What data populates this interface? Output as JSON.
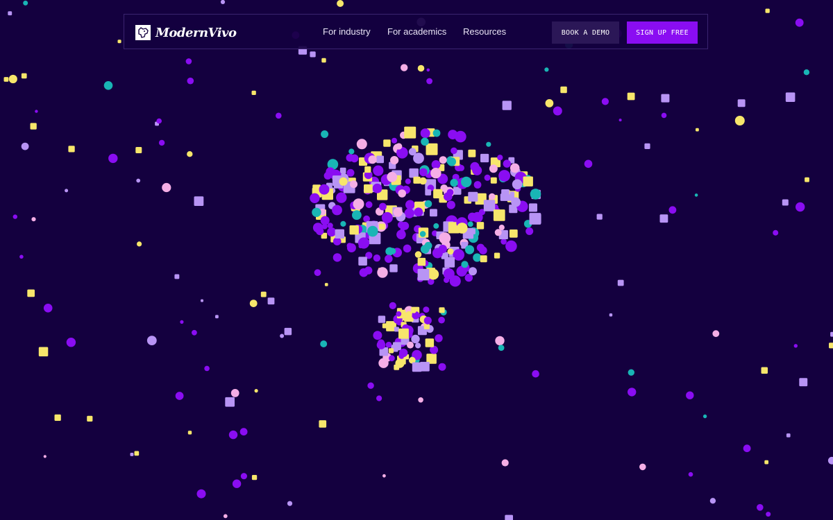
{
  "brand": {
    "name": "ModernVivo",
    "logo_icon": "dog-head-logo-icon"
  },
  "nav": {
    "links": [
      {
        "label": "For industry"
      },
      {
        "label": "For academics"
      },
      {
        "label": "Resources"
      }
    ]
  },
  "cta": {
    "demo_label": "BOOK A DEMO",
    "signup_label": "SIGN UP FREE"
  },
  "colors": {
    "background": "#14003f",
    "purple": "#8a0df2",
    "lavender": "#b894f5",
    "yellow": "#f7e66b",
    "teal": "#19b5b5",
    "pink": "#f5aee6"
  },
  "hero": {
    "visual": "brain-shaped-particle-cloud"
  }
}
